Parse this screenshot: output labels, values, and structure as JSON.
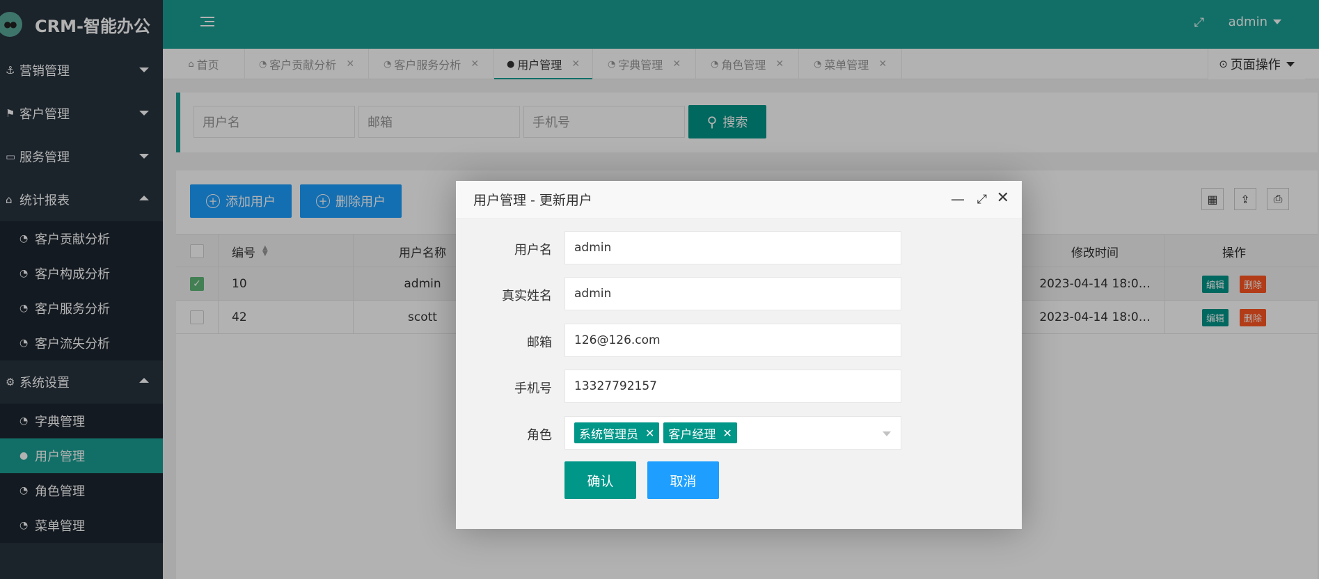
{
  "app": {
    "logo_text": "CRM-智能办公",
    "logo_icon": "glasses-icon"
  },
  "sidebar": {
    "groups": [
      {
        "label": "营销管理",
        "icon": "anchor-icon",
        "expanded": false
      },
      {
        "label": "客户管理",
        "icon": "flag-icon",
        "expanded": false
      },
      {
        "label": "服务管理",
        "icon": "monitor-icon",
        "expanded": false
      },
      {
        "label": "统计报表",
        "icon": "home-icon",
        "expanded": true,
        "items": [
          "客户贡献分析",
          "客户构成分析",
          "客户服务分析",
          "客户流失分析"
        ]
      },
      {
        "label": "系统设置",
        "icon": "cogs-icon",
        "expanded": true,
        "items": [
          "字典管理",
          "用户管理",
          "角色管理",
          "菜单管理"
        ]
      }
    ],
    "active_item": "用户管理"
  },
  "header": {
    "user": "admin"
  },
  "tabs": {
    "items": [
      "首页",
      "客户贡献分析",
      "客户服务分析",
      "用户管理",
      "字典管理",
      "角色管理",
      "菜单管理"
    ],
    "active": "用户管理",
    "page_ops": "页面操作"
  },
  "search": {
    "username_placeholder": "用户名",
    "email_placeholder": "邮箱",
    "phone_placeholder": "手机号",
    "button": "搜索"
  },
  "toolbar": {
    "add": "添加用户",
    "delete": "删除用户"
  },
  "table": {
    "headers": {
      "id": "编号",
      "username": "用户名称",
      "updated": "修改时间",
      "ops": "操作"
    },
    "rows": [
      {
        "id": "10",
        "username": "admin",
        "updated": "2023-04-14 18:0…",
        "checked": true
      },
      {
        "id": "42",
        "username": "scott",
        "updated": "2023-04-14 18:0…",
        "checked": false
      }
    ],
    "edit": "编辑",
    "delete": "删除"
  },
  "modal": {
    "title": "用户管理 - 更新用户",
    "fields": {
      "username_label": "用户名",
      "username_value": "admin",
      "realname_label": "真实姓名",
      "realname_value": "admin",
      "email_label": "邮箱",
      "email_value": "126@126.com",
      "phone_label": "手机号",
      "phone_value": "13327792157",
      "role_label": "角色"
    },
    "roles": [
      "系统管理员",
      "客户经理"
    ],
    "confirm": "确认",
    "cancel": "取消"
  },
  "colors": {
    "primary": "#1aa094",
    "blue": "#1e9fff",
    "danger": "#ff5722",
    "sidebar": "#28333e"
  }
}
